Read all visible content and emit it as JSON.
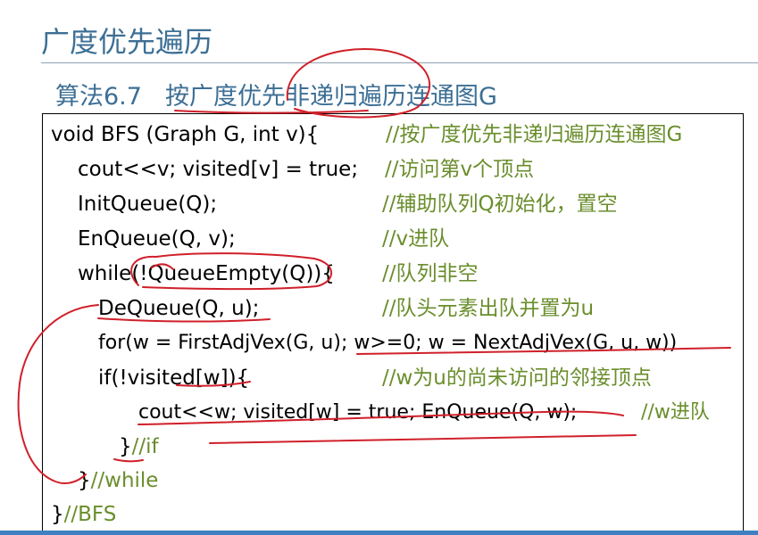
{
  "slide": {
    "title": "广度优先遍历",
    "algorithm_number": "算法6.7",
    "algorithm_name": "按广度优先非递归遍历连通图G"
  },
  "code": [
    {
      "code": "void BFS (Graph G, int v){",
      "comment": "//按广度优先非递归遍历连通图G"
    },
    {
      "code": "cout<<v; visited[v] = true;",
      "comment": "//访问第v个顶点"
    },
    {
      "code": "InitQueue(Q);",
      "comment": "//辅助队列Q初始化，置空"
    },
    {
      "code": "EnQueue(Q, v);",
      "comment": "//v进队"
    },
    {
      "code": "while(!QueueEmpty(Q)){",
      "comment": "//队列非空"
    },
    {
      "code": "DeQueue(Q, u);",
      "comment": "//队头元素出队并置为u"
    },
    {
      "code": "for(w = FirstAdjVex(G, u); w>=0; w = NextAdjVex(G, u, w))",
      "comment": ""
    },
    {
      "code": "if(!visited[w]){",
      "comment": "//w为u的尚未访问的邻接顶点"
    },
    {
      "code": "cout<<w; visited[w] = true;    EnQueue(Q, w);",
      "comment": "//w进队"
    },
    {
      "code": "}",
      "comment": "//if"
    },
    {
      "code": "}",
      "comment": "//while"
    },
    {
      "code": "}",
      "comment": "//BFS"
    }
  ],
  "colors": {
    "title": "#3d6f95",
    "comment": "#6a8e2c",
    "annotation": "#d0202a",
    "accent_bar": "#3f7fc2"
  }
}
